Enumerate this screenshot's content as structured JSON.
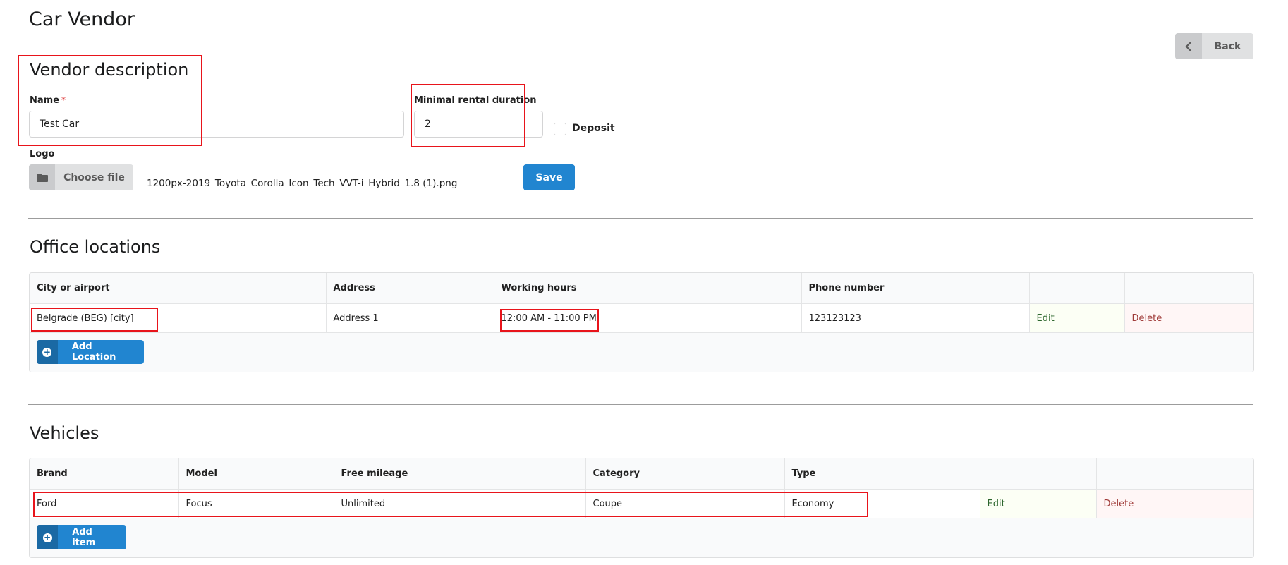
{
  "page": {
    "title": "Car Vendor",
    "back_label": "Back"
  },
  "vendor": {
    "section_title": "Vendor description",
    "name_label": "Name",
    "required_mark": "*",
    "name_value": "Test Car",
    "min_rental_label": "Minimal rental duration",
    "min_rental_value": "2",
    "deposit_label": "Deposit",
    "deposit_checked": false,
    "logo_label": "Logo",
    "choose_file_label": "Choose file",
    "file_name": "1200px-2019_Toyota_Corolla_Icon_Tech_VVT-i_Hybrid_1.8 (1).png",
    "save_label": "Save"
  },
  "offices": {
    "section_title": "Office locations",
    "columns": [
      "City or airport",
      "Address",
      "Working hours",
      "Phone number",
      "",
      ""
    ],
    "rows": [
      {
        "city": "Belgrade (BEG) [city]",
        "address": "Address 1",
        "hours": "12:00 AM - 11:00 PM",
        "phone": "123123123",
        "edit": "Edit",
        "delete": "Delete"
      }
    ],
    "add_label": "Add Location"
  },
  "vehicles": {
    "section_title": "Vehicles",
    "columns": [
      "Brand",
      "Model",
      "Free mileage",
      "Category",
      "Type",
      "",
      ""
    ],
    "rows": [
      {
        "brand": "Ford",
        "model": "Focus",
        "mileage": "Unlimited",
        "category": "Coupe",
        "type": "Economy",
        "edit": "Edit",
        "delete": "Delete"
      }
    ],
    "add_label": "Add item"
  },
  "colors": {
    "primary": "#2185d0",
    "highlight": "#e8141b",
    "edit_text": "#2c662d",
    "delete_text": "#9f3a38"
  },
  "icons": {
    "back": "chevron-left-icon",
    "file": "folder-icon",
    "add": "plus-circle-icon"
  }
}
